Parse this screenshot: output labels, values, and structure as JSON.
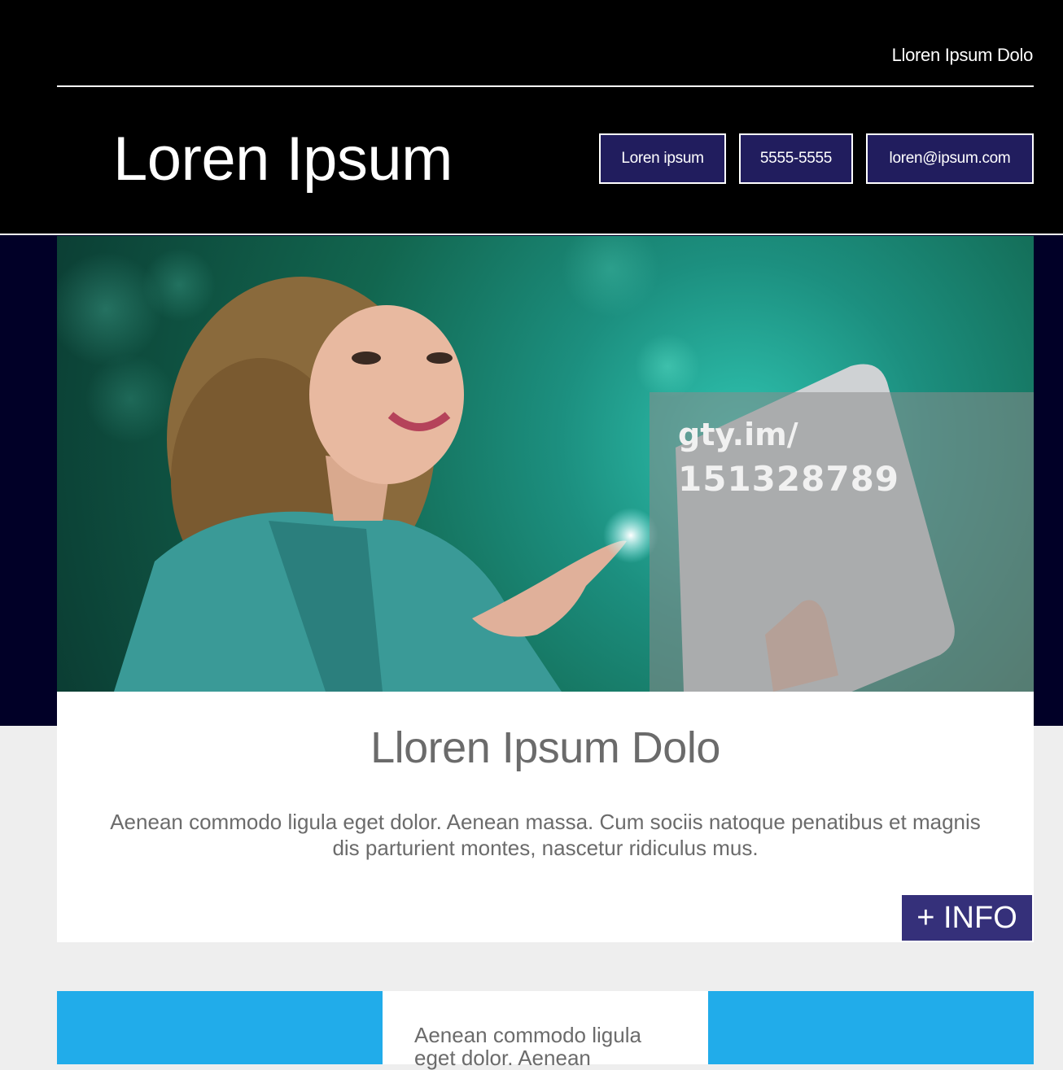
{
  "header": {
    "top_link": "Lloren Ipsum Dolo",
    "brand": "Loren Ipsum",
    "contacts": [
      "Loren ipsum",
      "5555-5555",
      "loren@ipsum.com"
    ]
  },
  "hero": {
    "watermark_line1": "gty.im/",
    "watermark_line2": "151328789"
  },
  "feature": {
    "title": "Lloren Ipsum Dolo",
    "text": "Aenean commodo ligula eget dolor. Aenean massa. Cum sociis natoque penatibus et magnis dis parturient montes, nascetur ridiculus mus.",
    "info_button": "+ INFO"
  },
  "tiles": {
    "middle_text": "Aenean commodo ligula eget dolor. Aenean"
  },
  "colors": {
    "header_bg": "#000000",
    "button_bg": "#211d5e",
    "hero_band": "#010027",
    "info_button": "#35307a",
    "tile_blue": "#21acea"
  }
}
